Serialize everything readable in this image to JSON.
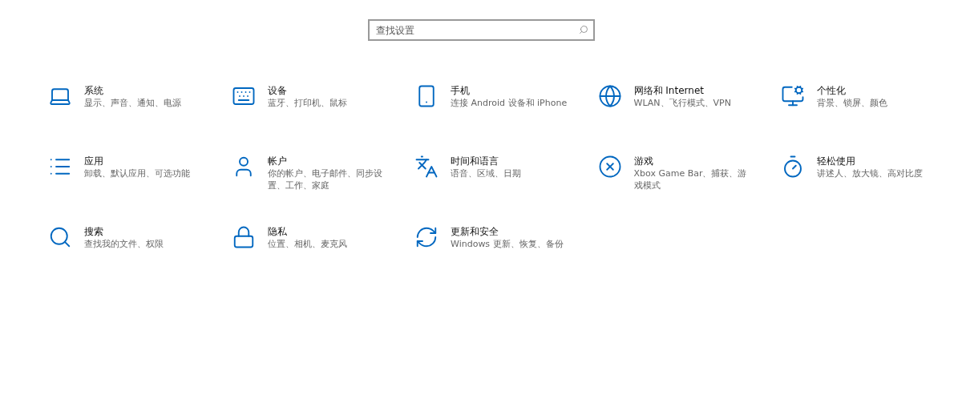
{
  "search": {
    "placeholder": "查找设置"
  },
  "tiles": [
    {
      "title": "系统",
      "description": "显示、声音、通知、电源"
    },
    {
      "title": "设备",
      "description": "蓝牙、打印机、鼠标"
    },
    {
      "title": "手机",
      "description": "连接 Android 设备和 iPhone"
    },
    {
      "title": "网络和 Internet",
      "description": "WLAN、飞行模式、VPN"
    },
    {
      "title": "个性化",
      "description": "背景、锁屏、颜色"
    },
    {
      "title": "应用",
      "description": "卸载、默认应用、可选功能"
    },
    {
      "title": "帐户",
      "description": "你的帐户、电子邮件、同步设置、工作、家庭"
    },
    {
      "title": "时间和语言",
      "description": "语音、区域、日期"
    },
    {
      "title": "游戏",
      "description": "Xbox Game Bar、捕获、游戏模式"
    },
    {
      "title": "轻松使用",
      "description": "讲述人、放大镜、高对比度"
    },
    {
      "title": "搜索",
      "description": "查找我的文件、权限"
    },
    {
      "title": "隐私",
      "description": "位置、相机、麦克风"
    },
    {
      "title": "更新和安全",
      "description": "Windows 更新、恢复、备份"
    }
  ]
}
